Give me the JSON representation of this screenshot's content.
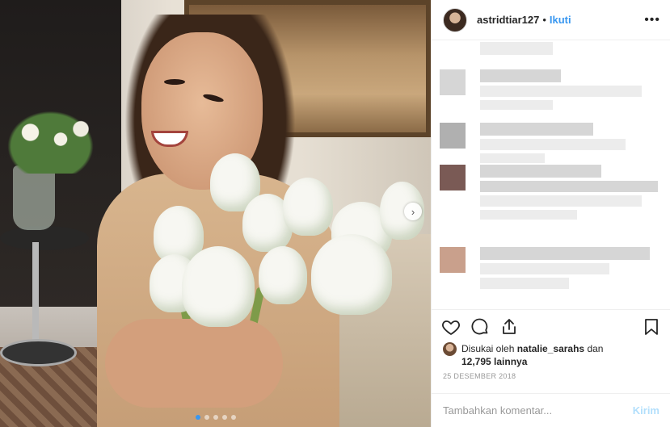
{
  "post": {
    "username": "astridtiar127",
    "separator": "•",
    "follow_label": "Ikuti",
    "more_label": "•••"
  },
  "photo": {
    "carousel_total": 5,
    "carousel_active": 1,
    "next_label": "›"
  },
  "likes": {
    "prefix": "Disukai oleh",
    "first_liker": "natalie_sarahs",
    "conjunction": "dan",
    "others": "12,795 lainnya"
  },
  "date": "25 DESEMBER 2018",
  "comment_box": {
    "placeholder": "Tambahkan komentar...",
    "post_label": "Kirim"
  },
  "colors": {
    "accent": "#3897f0",
    "post_disabled": "#b2dffc",
    "text": "#262626",
    "muted": "#999999"
  },
  "icons": {
    "like": "heart-icon",
    "comment": "comment-icon",
    "share": "share-icon",
    "save": "bookmark-icon",
    "more": "more-icon",
    "next": "chevron-right-icon"
  }
}
